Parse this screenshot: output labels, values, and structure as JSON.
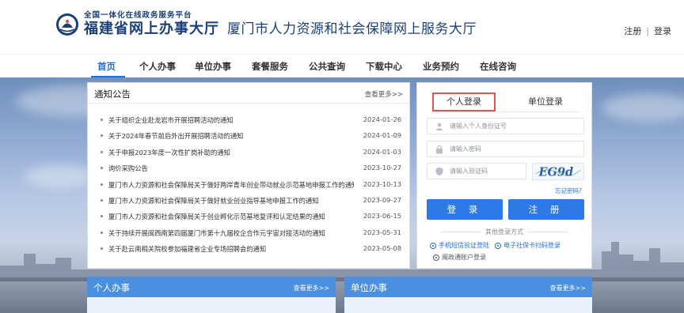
{
  "header": {
    "logo_small": "全国一体化在线政务服务平台",
    "logo_big": "福建省网上办事大厅",
    "site_title": "厦门市人力资源和社会保障网上服务大厅",
    "register_link": "注册",
    "separator": "|",
    "login_link": "登录"
  },
  "nav": {
    "items": [
      "首页",
      "个人办事",
      "单位办事",
      "套餐服务",
      "公共查询",
      "下载中心",
      "业务预约",
      "在线咨询"
    ],
    "active": "首页"
  },
  "notice": {
    "title": "通知公告",
    "more": "查看更多>>",
    "items": [
      {
        "text": "关于组织企业赴龙岩市开展招聘活动的通知",
        "date": "2024-01-26"
      },
      {
        "text": "关于2024年春节前后外出开展招聘活动的通知",
        "date": "2024-01-09"
      },
      {
        "text": "关于申报2023年度一次性扩岗补助的通知",
        "date": "2024-01-03"
      },
      {
        "text": "询价采购公告",
        "date": "2023-10-27"
      },
      {
        "text": "厦门市人力资源和社会保障局关于做好两岸青年创业带动就业示范基地申报工作的通知",
        "date": "2023-10-13"
      },
      {
        "text": "厦门市人力资源和社会保障局关于做好就业创业指导基地申报工作的通知",
        "date": "2023-09-27"
      },
      {
        "text": "厦门市人力资源和社会保障局关于创业孵化示范基地复评和认定结果的通知",
        "date": "2023-06-15"
      },
      {
        "text": "关于持续开展闽西南第四届厦门市第十九届校企合作元宇宙对接活动的通知",
        "date": "2023-05-31"
      },
      {
        "text": "关于赴云南相关院校参加福建省企业专场招聘会的通知",
        "date": "2023-05-08"
      }
    ]
  },
  "login": {
    "tab_personal": "个人登录",
    "tab_unit": "单位登录",
    "id_placeholder": "请输入个人身份证号",
    "password_placeholder": "请输入密码",
    "captcha_placeholder": "请输入验证码",
    "captcha_text": "EG9d",
    "forgot": "忘记密码?",
    "login_button": "登 录",
    "register_button": "注 册",
    "other_methods": "其他登录方式",
    "alt_sms": "手机短信验证登陆",
    "alt_card": "电子社保卡扫码登录",
    "alt_mail": "闽政通账户登录"
  },
  "sections": {
    "personal": {
      "title": "个人办事",
      "more": "查看更多>>"
    },
    "unit": {
      "title": "单位办事",
      "more": "查看更多>>"
    }
  },
  "colors": {
    "brand": "#1b3f78",
    "accent": "#1f6fd6",
    "button": "#2d79e6",
    "tab_highlight": "#e05454",
    "section_bar": "#4a8fe0"
  }
}
